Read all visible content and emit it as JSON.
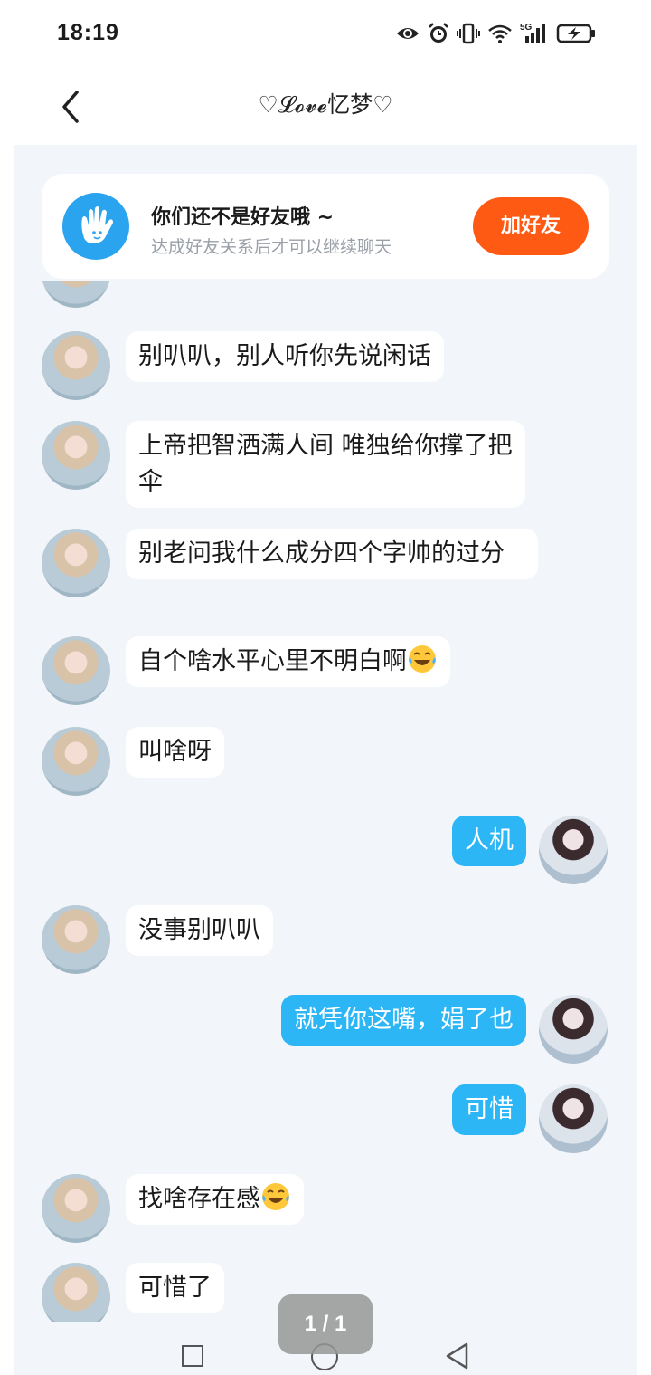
{
  "status_bar": {
    "time": "18:19",
    "icons": [
      "eye-icon",
      "alarm-icon",
      "vibrate-icon",
      "wifi-icon",
      "signal-5g-icon",
      "battery-charging-icon"
    ],
    "network_label": "5G"
  },
  "header": {
    "title": "♡𝓛𝓸𝓿𝓮忆梦♡"
  },
  "friend_banner": {
    "title": "你们还不是好友哦 ~",
    "subtitle": "达成好友关系后才可以继续聊天",
    "add_button": "加好友",
    "accent": "#ff5a14",
    "icon_color": "#2ba4f0"
  },
  "messages": [
    {
      "side": "in",
      "text": "别叭叭，别人听你先说闲话"
    },
    {
      "side": "in",
      "text": "上帝把智洒满人间  唯独给你撑了把伞"
    },
    {
      "side": "in",
      "text": "别老问我什么成分四个字帅的过分"
    },
    {
      "side": "in",
      "text": "自个啥水平心里不明白啊",
      "emoji": "laughing-tears-emoji"
    },
    {
      "side": "in",
      "text": "叫啥呀"
    },
    {
      "side": "out",
      "text": "人机"
    },
    {
      "side": "in",
      "text": "没事别叭叭"
    },
    {
      "side": "out",
      "text": "就凭你这嘴，娟了也"
    },
    {
      "side": "out",
      "text": "可惜"
    },
    {
      "side": "in",
      "text": "找啥存在感",
      "emoji": "laughing-tears-emoji"
    },
    {
      "side": "in",
      "text": "可惜了"
    }
  ],
  "page_indicator": "1 / 1",
  "colors": {
    "outgoing_bubble": "#2db6f5",
    "incoming_bubble": "#ffffff",
    "background": "#f2f5f9"
  }
}
